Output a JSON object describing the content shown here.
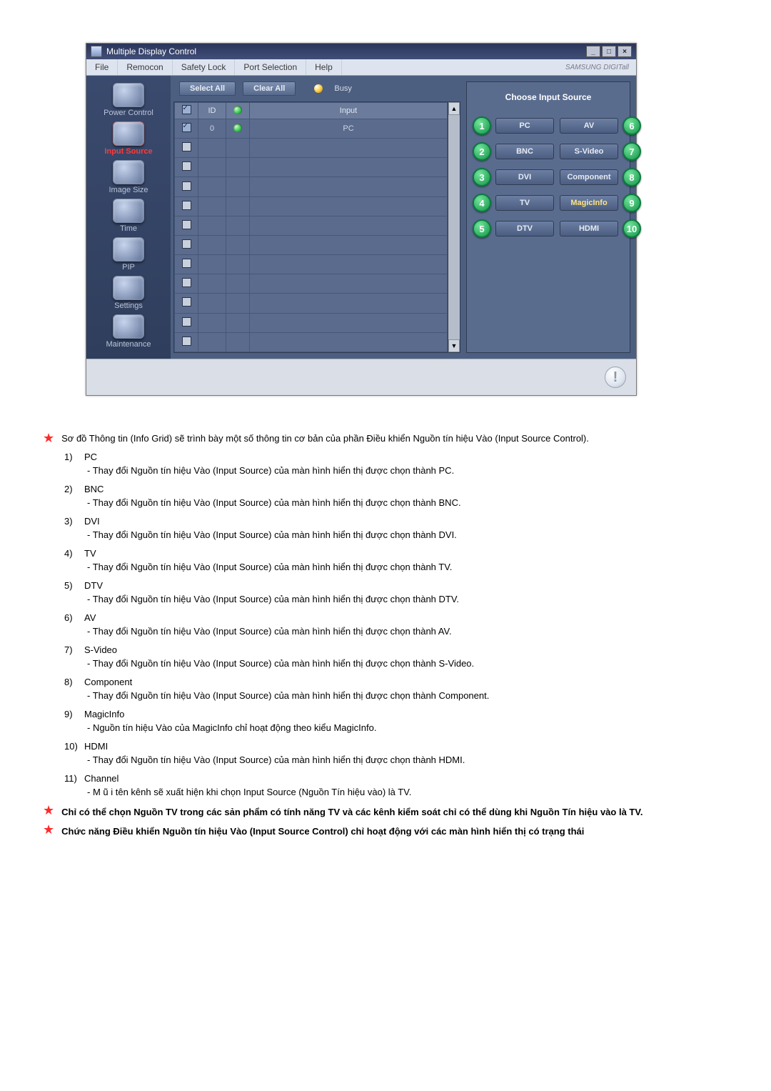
{
  "window": {
    "title": "Multiple Display Control",
    "menus": [
      "File",
      "Remocon",
      "Safety Lock",
      "Port Selection",
      "Help"
    ],
    "brand": "SAMSUNG DIGITall"
  },
  "sidebar": {
    "items": [
      {
        "label": "Power Control"
      },
      {
        "label": "Input Source",
        "active": true
      },
      {
        "label": "Image Size"
      },
      {
        "label": "Time"
      },
      {
        "label": "PIP"
      },
      {
        "label": "Settings"
      },
      {
        "label": "Maintenance"
      }
    ]
  },
  "toolbar": {
    "select_all": "Select All",
    "clear_all": "Clear All",
    "busy": "Busy"
  },
  "grid": {
    "headers": {
      "check": "✓",
      "id": "ID",
      "status": "",
      "input": "Input"
    },
    "rows": [
      {
        "checked": true,
        "id": "0",
        "status": "green",
        "input": "PC"
      },
      {
        "checked": false
      },
      {
        "checked": false
      },
      {
        "checked": false
      },
      {
        "checked": false
      },
      {
        "checked": false
      },
      {
        "checked": false
      },
      {
        "checked": false
      },
      {
        "checked": false
      },
      {
        "checked": false
      },
      {
        "checked": false
      },
      {
        "checked": false
      }
    ]
  },
  "source_panel": {
    "title": "Choose Input Source",
    "left": [
      {
        "n": "1",
        "label": "PC"
      },
      {
        "n": "2",
        "label": "BNC"
      },
      {
        "n": "3",
        "label": "DVI"
      },
      {
        "n": "4",
        "label": "TV"
      },
      {
        "n": "5",
        "label": "DTV"
      }
    ],
    "right": [
      {
        "n": "6",
        "label": "AV"
      },
      {
        "n": "7",
        "label": "S-Video"
      },
      {
        "n": "8",
        "label": "Component"
      },
      {
        "n": "9",
        "label": "MagicInfo",
        "magic": true
      },
      {
        "n": "10",
        "label": "HDMI"
      }
    ]
  },
  "doc": {
    "intro": "Sơ đồ Thông tin (Info Grid) sẽ trình bày một số thông tin cơ bản của phần Điều khiển Nguồn tín hiệu Vào (Input Source Control).",
    "items": [
      {
        "n": "1)",
        "t": "PC",
        "d": "- Thay đổi Nguồn tín hiệu Vào (Input Source) của màn hình hiển thị được chọn thành PC."
      },
      {
        "n": "2)",
        "t": "BNC",
        "d": "- Thay đổi Nguồn tín hiệu Vào (Input Source) của màn hình hiển thị được chọn thành BNC."
      },
      {
        "n": "3)",
        "t": "DVI",
        "d": "- Thay đổi Nguồn tín hiệu Vào (Input Source) của màn hình hiển thị được chọn thành DVI."
      },
      {
        "n": "4)",
        "t": "TV",
        "d": "- Thay đổi Nguồn tín hiệu Vào (Input Source) của màn hình hiển thị được chọn thành TV."
      },
      {
        "n": "5)",
        "t": "DTV",
        "d": "- Thay đổi Nguồn tín hiệu Vào (Input Source) của màn hình hiển thị được chọn thành DTV."
      },
      {
        "n": "6)",
        "t": "AV",
        "d": "- Thay đổi Nguồn tín hiệu Vào (Input Source) của màn hình hiển thị được chọn thành AV."
      },
      {
        "n": "7)",
        "t": "S-Video",
        "d": "- Thay đổi Nguồn tín hiệu Vào (Input Source) của màn hình hiển thị được chọn thành S-Video."
      },
      {
        "n": "8)",
        "t": "Component",
        "d": "- Thay đổi Nguồn tín hiệu Vào (Input Source) của màn hình hiển thị được chọn thành Component."
      },
      {
        "n": "9)",
        "t": "MagicInfo",
        "d": "- Nguồn tín hiệu Vào của MagicInfo chỉ hoạt động theo kiểu MagicInfo."
      },
      {
        "n": "10)",
        "t": "HDMI",
        "d": "- Thay đổi Nguồn tín hiệu Vào (Input Source) của màn hình hiển thị được chọn thành HDMI."
      },
      {
        "n": "11)",
        "t": "Channel",
        "d": "- M ũ i tên kênh sẽ xuất hiện khi chọn Input Source (Nguồn Tín hiệu vào) là TV."
      }
    ],
    "note1": "Chỉ có thể chọn Nguồn TV trong các sản phẩm có tính năng TV và các kênh kiểm soát chỉ có thể dùng khi Nguồn Tín hiệu vào là TV.",
    "note2": "Chức năng Điều khiển Nguồn tín hiệu Vào (Input Source Control) chỉ hoạt động với các màn hình hiển thị có trạng thái"
  }
}
